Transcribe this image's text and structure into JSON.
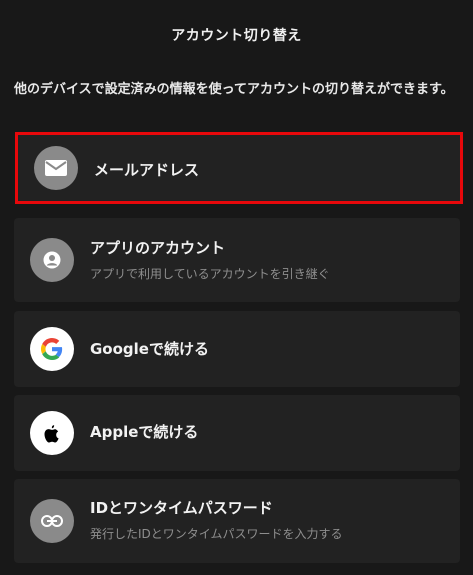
{
  "header": {
    "title": "アカウント切り替え"
  },
  "description": "他のデバイスで設定済みの情報を使ってアカウントの切り替えができます。",
  "options": [
    {
      "title": "メールアドレス",
      "subtitle": "",
      "icon": "mail-icon",
      "selected": true
    },
    {
      "title": "アプリのアカウント",
      "subtitle": "アプリで利用しているアカウントを引き継ぐ",
      "icon": "user-icon",
      "selected": false
    },
    {
      "title": "Googleで続ける",
      "subtitle": "",
      "icon": "google-icon",
      "selected": false
    },
    {
      "title": "Appleで続ける",
      "subtitle": "",
      "icon": "apple-icon",
      "selected": false
    },
    {
      "title": "IDとワンタイムパスワード",
      "subtitle": "発行したIDとワンタイムパスワードを入力する",
      "icon": "link-icon",
      "selected": false
    }
  ],
  "colors": {
    "background": "#181818",
    "card": "#222222",
    "selected_border": "#e8080b",
    "icon_gray": "#8a8a8a"
  }
}
